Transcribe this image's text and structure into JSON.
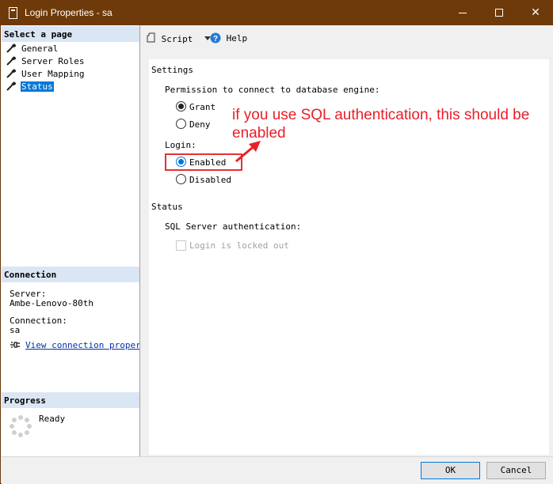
{
  "window": {
    "title": "Login Properties - sa",
    "minimize_glyph": "",
    "maximize_glyph": "",
    "close_glyph": "✕"
  },
  "left": {
    "select_page_heading": "Select a page",
    "pages": [
      {
        "label": "General",
        "icon": "wrench-icon"
      },
      {
        "label": "Server Roles",
        "icon": "wrench-icon"
      },
      {
        "label": "User Mapping",
        "icon": "wrench-icon"
      },
      {
        "label": "Status",
        "icon": "wrench-icon",
        "selected": true
      }
    ],
    "connection_heading": "Connection",
    "server_label": "Server:",
    "server_value": "Ambe-Lenovo-80th",
    "connection_label": "Connection:",
    "connection_value": "sa",
    "view_connection_link": "View connection properties",
    "progress_heading": "Progress",
    "progress_status": "Ready"
  },
  "toolbar": {
    "script_label": "Script",
    "help_label": "Help"
  },
  "settings": {
    "heading": "Settings",
    "permission_label": "Permission to connect to database engine:",
    "permission_options": [
      {
        "label": "Grant",
        "checked": true
      },
      {
        "label": "Deny",
        "checked": false
      }
    ],
    "login_label": "Login:",
    "login_options": [
      {
        "label": "Enabled",
        "checked": true
      },
      {
        "label": "Disabled",
        "checked": false
      }
    ]
  },
  "status": {
    "heading": "Status",
    "sql_auth_label": "SQL Server authentication:",
    "locked_out_label": "Login is locked out",
    "locked_out_checked": false
  },
  "annotation": {
    "text_line1": "if you use SQL authentication, this should be",
    "text_line2": "enabled",
    "color": "#e8202a"
  },
  "buttons": {
    "ok_label": "OK",
    "cancel_label": "Cancel"
  },
  "colors": {
    "titlebar": "#6f3a09",
    "section_header": "#dbe6f4",
    "selection": "#0078d7",
    "highlight_box": "#e63030"
  }
}
